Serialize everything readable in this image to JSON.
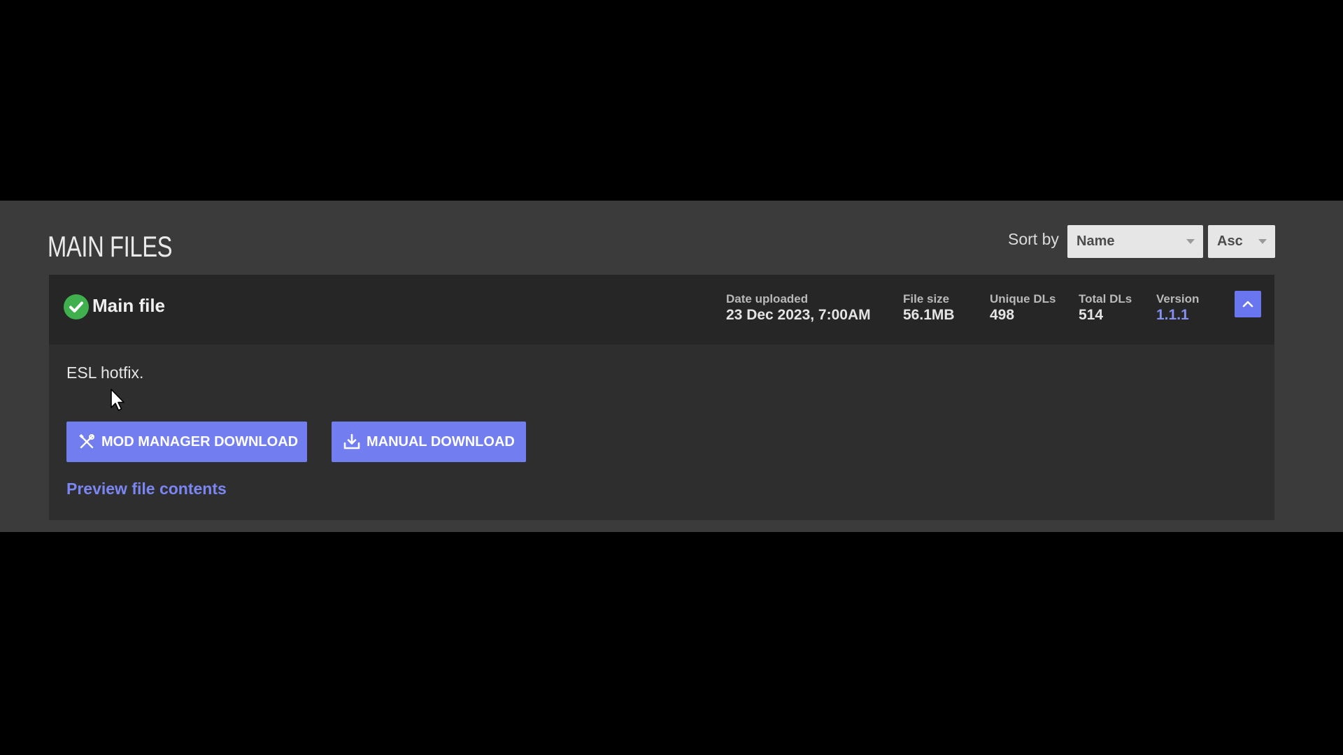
{
  "section": {
    "title": "MAIN FILES"
  },
  "sort": {
    "label": "Sort by",
    "field_value": "Name",
    "order_value": "Asc"
  },
  "file": {
    "name": "Main file",
    "stats": {
      "date_label": "Date uploaded",
      "date_value": "23 Dec 2023, 7:00AM",
      "size_label": "File size",
      "size_value": "56.1MB",
      "unique_label": "Unique DLs",
      "unique_value": "498",
      "total_label": "Total DLs",
      "total_value": "514",
      "version_label": "Version",
      "version_value": "1.1.1"
    },
    "description": "ESL hotfix.",
    "mod_manager_download_label": "MOD MANAGER DOWNLOAD",
    "manual_download_label": "MANUAL DOWNLOAD",
    "preview_link_label": "Preview file contents"
  },
  "icons": {
    "status": "check-circle-icon",
    "collapse": "chevron-up-icon",
    "mod_manager": "wrench-screwdriver-icon",
    "manual": "download-icon",
    "pointer": "mouse-cursor-icon"
  },
  "colors": {
    "accent": "#727ef0",
    "link": "#7b86f2",
    "success": "#3fb04d",
    "panel": "#3b3b3b",
    "card": "#2e2e2e",
    "card_header": "#262626"
  }
}
